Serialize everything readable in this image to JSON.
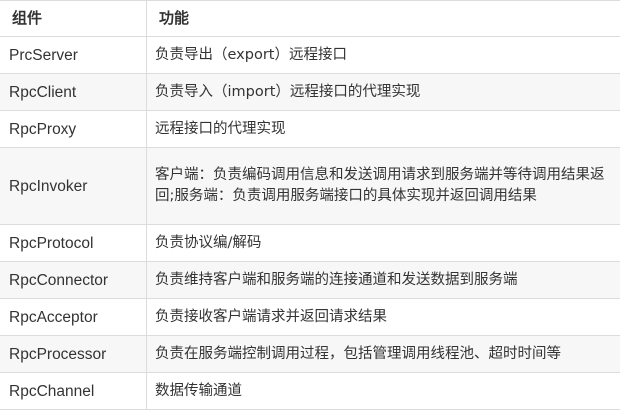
{
  "table": {
    "headers": {
      "component": "组件",
      "function": "功能"
    },
    "rows": [
      {
        "name": "PrcServer",
        "desc": "负责导出（export）远程接口"
      },
      {
        "name": "RpcClient",
        "desc": "负责导入（import）远程接口的代理实现"
      },
      {
        "name": "RpcProxy",
        "desc": "远程接口的代理实现"
      },
      {
        "name": "RpcInvoker",
        "desc": "客户端：负责编码调用信息和发送调用请求到服务端并等待调用结果返回;服务端：负责调用服务端接口的具体实现并返回调用结果"
      },
      {
        "name": "RpcProtocol",
        "desc": "负责协议编/解码"
      },
      {
        "name": "RpcConnector",
        "desc": "负责维持客户端和服务端的连接通道和发送数据到服务端"
      },
      {
        "name": "RpcAcceptor",
        "desc": "负责接收客户端请求并返回请求结果"
      },
      {
        "name": "RpcProcessor",
        "desc": "负责在服务端控制调用过程，包括管理调用线程池、超时时间等"
      },
      {
        "name": "RpcChannel",
        "desc": "数据传输通道"
      }
    ]
  }
}
